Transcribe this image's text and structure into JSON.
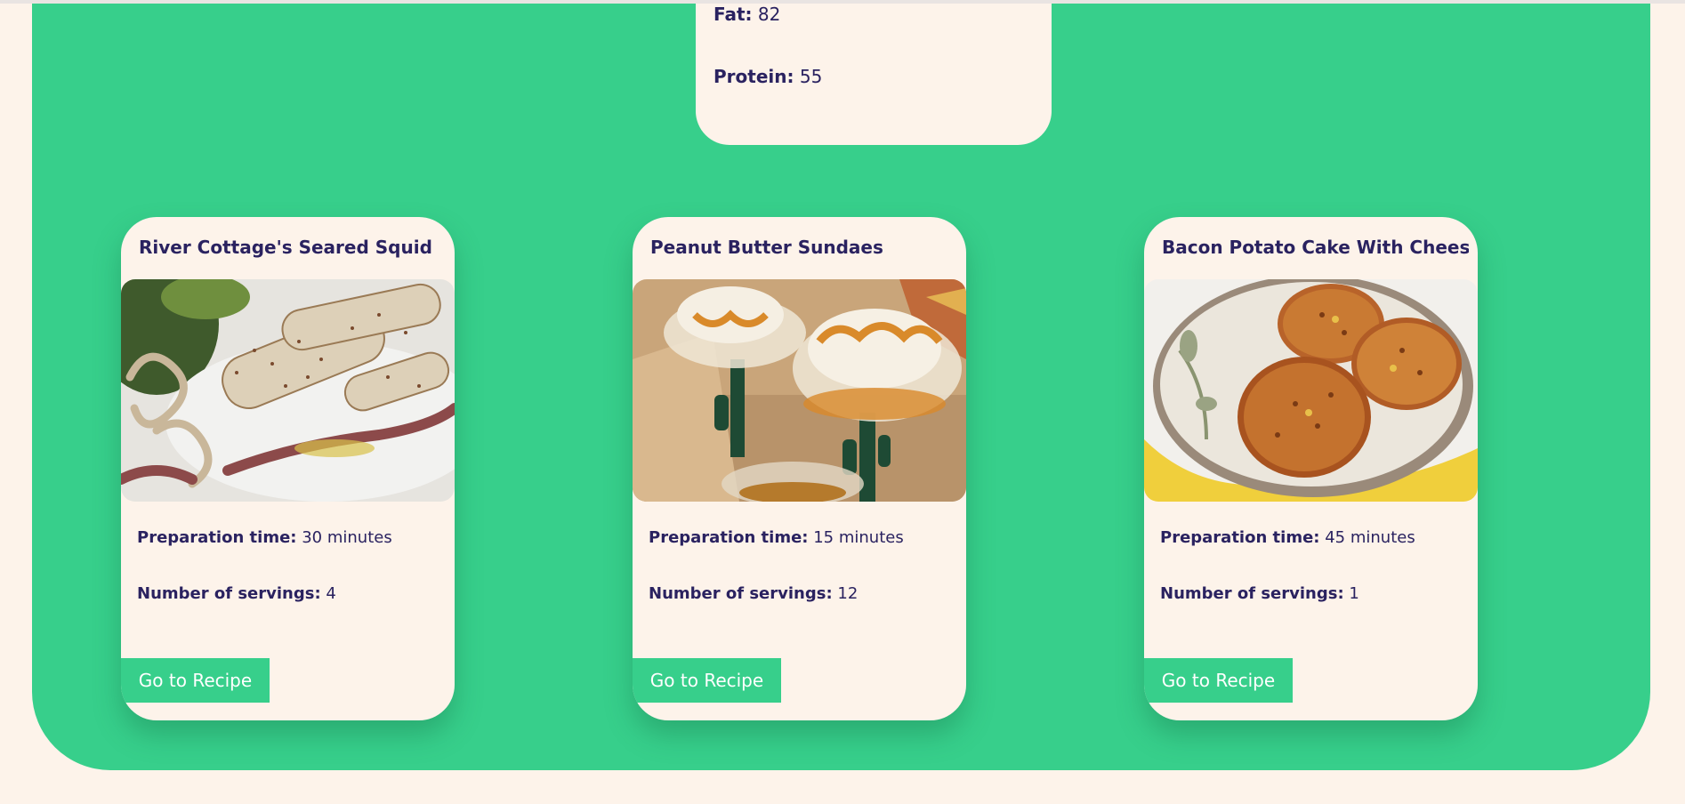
{
  "nutrition": {
    "fat_label": "Fat:",
    "fat_value": "82",
    "protein_label": "Protein:",
    "protein_value": "55"
  },
  "recipes": [
    {
      "title": "River Cottage's Seared Squid",
      "image_alt": "seared squid",
      "prep_label": "Preparation time:",
      "prep_value": "30 minutes",
      "servings_label": "Number of servings:",
      "servings_value": "4",
      "button_label": "Go to Recipe"
    },
    {
      "title": "Peanut Butter Sundaes",
      "image_alt": "peanut butter sundaes",
      "prep_label": "Preparation time:",
      "prep_value": "15 minutes",
      "servings_label": "Number of servings:",
      "servings_value": "12",
      "button_label": "Go to Recipe"
    },
    {
      "title": "Bacon Potato Cake With Cheese",
      "image_alt": "bacon potato cakes",
      "prep_label": "Preparation time:",
      "prep_value": "45 minutes",
      "servings_label": "Number of servings:",
      "servings_value": "1",
      "button_label": "Go to Recipe"
    }
  ],
  "colors": {
    "page_background": "#fdf3ea",
    "panel_green": "#37cf8b",
    "text_navy": "#2a2260",
    "button_text": "#ffffff"
  }
}
